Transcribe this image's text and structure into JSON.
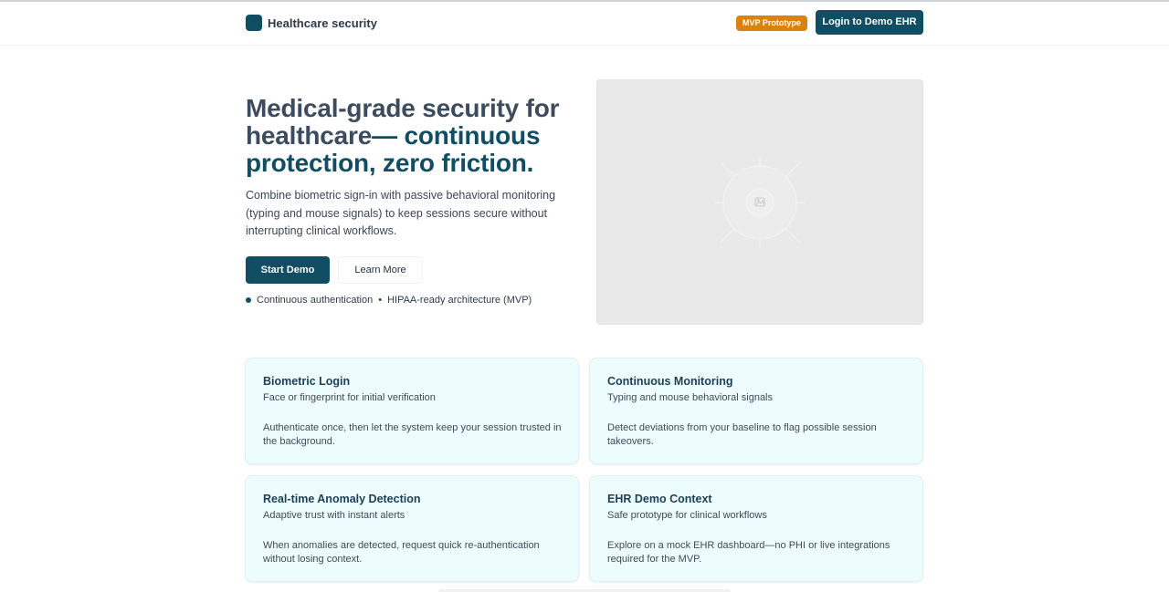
{
  "header": {
    "brand": "Healthcare security",
    "badge": "MVP Prototype",
    "login_label": "Login to Demo EHR"
  },
  "hero": {
    "title_part1": "Medical-grade security for healthcare",
    "title_part2": "— continuous protection, zero friction.",
    "description": "Combine biometric sign-in with passive behavioral monitoring (typing and mouse signals) to keep sessions secure without interrupting clinical workflows.",
    "primary_button": "Start Demo",
    "secondary_button": "Learn More",
    "feature_1": "Continuous authentication",
    "separator": "•",
    "feature_2": "HIPAA-ready architecture (MVP)",
    "media_icon": "image-placeholder-icon"
  },
  "cards": [
    {
      "title": "Biometric Login",
      "subtitle": "Face or fingerprint for initial verification",
      "body": "Authenticate once, then let the system keep your session trusted in the background."
    },
    {
      "title": "Continuous Monitoring",
      "subtitle": "Typing and mouse behavioral signals",
      "body": "Detect deviations from your baseline to flag possible session takeovers."
    },
    {
      "title": "Real-time Anomaly Detection",
      "subtitle": "Adaptive trust with instant alerts",
      "body": "When anomalies are detected, request quick re-authentication without losing context."
    },
    {
      "title": "EHR Demo Context",
      "subtitle": "Safe prototype for clinical workflows",
      "body": "Explore on a mock EHR dashboard—no PHI or live integrations required for the MVP."
    }
  ],
  "colors": {
    "primary": "#124e63",
    "badge": "#d9820f",
    "card_bg": "#edfcfd"
  }
}
